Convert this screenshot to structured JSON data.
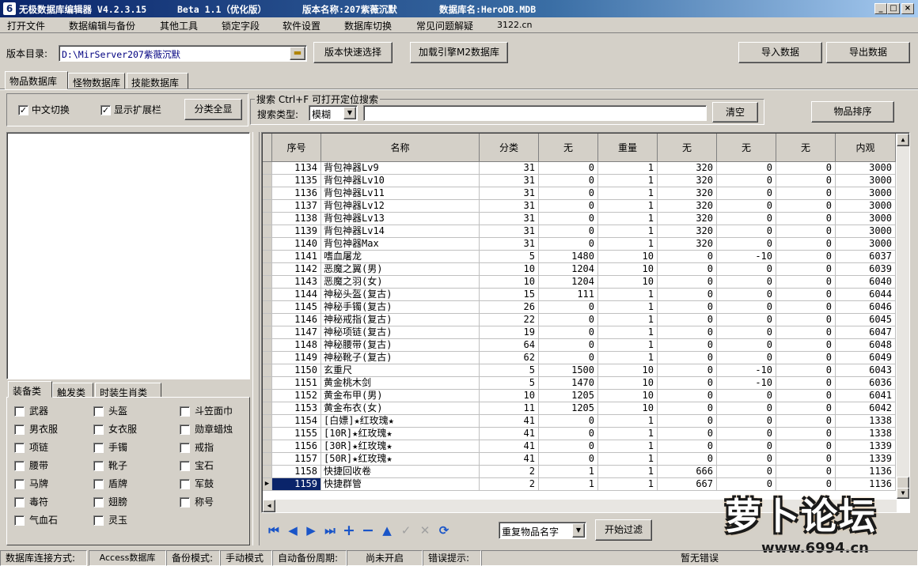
{
  "window": {
    "title_app": "无极数据库编辑器 V4.2.3.15",
    "title_beta": "Beta 1.1（优化版）",
    "title_version": "版本名称:207紫薇沉默",
    "title_db": "数据库名:HeroDB.MDB"
  },
  "menu": [
    "打开文件",
    "数据编辑与备份",
    "其他工具",
    "锁定字段",
    "软件设置",
    "数据库切换",
    "常见问题解疑",
    "3122.cn"
  ],
  "toolbar": {
    "dir_label": "版本目录:",
    "dir_value": "D:\\MirServer207紫薇沉默",
    "quick_select": "版本快速选择",
    "load_engine": "加载引擎M2数据库",
    "import": "导入数据",
    "export": "导出数据"
  },
  "tabs": [
    "物品数据库",
    "怪物数据库",
    "技能数据库"
  ],
  "options": {
    "chinese_switch": "中文切换",
    "show_ext": "显示扩展栏",
    "show_all": "分类全显",
    "search_group": "搜索  Ctrl+F 可打开定位搜索",
    "search_type_label": "搜索类型:",
    "search_type_value": "模糊",
    "clear": "清空",
    "sort": "物品排序"
  },
  "category_tabs": [
    "装备类",
    "触发类",
    "时装生肖类"
  ],
  "categories": [
    "武器",
    "头盔",
    "斗笠面巾",
    "男衣服",
    "女衣服",
    "勋章蜡烛",
    "项链",
    "手镯",
    "戒指",
    "腰带",
    "靴子",
    "宝石",
    "马牌",
    "盾牌",
    "军鼓",
    "毒符",
    "翅膀",
    "称号",
    "气血石",
    "灵玉"
  ],
  "columns": [
    "序号",
    "名称",
    "分类",
    "无",
    "重量",
    "无",
    "无",
    "无",
    "内观"
  ],
  "rows": [
    [
      "1134",
      "背包神器Lv9",
      "31",
      "0",
      "1",
      "320",
      "0",
      "0",
      "3000"
    ],
    [
      "1135",
      "背包神器Lv10",
      "31",
      "0",
      "1",
      "320",
      "0",
      "0",
      "3000"
    ],
    [
      "1136",
      "背包神器Lv11",
      "31",
      "0",
      "1",
      "320",
      "0",
      "0",
      "3000"
    ],
    [
      "1137",
      "背包神器Lv12",
      "31",
      "0",
      "1",
      "320",
      "0",
      "0",
      "3000"
    ],
    [
      "1138",
      "背包神器Lv13",
      "31",
      "0",
      "1",
      "320",
      "0",
      "0",
      "3000"
    ],
    [
      "1139",
      "背包神器Lv14",
      "31",
      "0",
      "1",
      "320",
      "0",
      "0",
      "3000"
    ],
    [
      "1140",
      "背包神器Max",
      "31",
      "0",
      "1",
      "320",
      "0",
      "0",
      "3000"
    ],
    [
      "1141",
      "嗜血屠龙",
      "5",
      "1480",
      "10",
      "0",
      "-10",
      "0",
      "6037"
    ],
    [
      "1142",
      "恶魔之翼(男)",
      "10",
      "1204",
      "10",
      "0",
      "0",
      "0",
      "6039"
    ],
    [
      "1143",
      "恶魔之羽(女)",
      "10",
      "1204",
      "10",
      "0",
      "0",
      "0",
      "6040"
    ],
    [
      "1144",
      "神秘头盔(复古)",
      "15",
      "111",
      "1",
      "0",
      "0",
      "0",
      "6044"
    ],
    [
      "1145",
      "神秘手镯(复古)",
      "26",
      "0",
      "1",
      "0",
      "0",
      "0",
      "6046"
    ],
    [
      "1146",
      "神秘戒指(复古)",
      "22",
      "0",
      "1",
      "0",
      "0",
      "0",
      "6045"
    ],
    [
      "1147",
      "神秘项链(复古)",
      "19",
      "0",
      "1",
      "0",
      "0",
      "0",
      "6047"
    ],
    [
      "1148",
      "神秘腰带(复古)",
      "64",
      "0",
      "1",
      "0",
      "0",
      "0",
      "6048"
    ],
    [
      "1149",
      "神秘靴子(复古)",
      "62",
      "0",
      "1",
      "0",
      "0",
      "0",
      "6049"
    ],
    [
      "1150",
      "玄重尺",
      "5",
      "1500",
      "10",
      "0",
      "-10",
      "0",
      "6043"
    ],
    [
      "1151",
      "黄金桃木剑",
      "5",
      "1470",
      "10",
      "0",
      "-10",
      "0",
      "6036"
    ],
    [
      "1152",
      "黄金布甲(男)",
      "10",
      "1205",
      "10",
      "0",
      "0",
      "0",
      "6041"
    ],
    [
      "1153",
      "黄金布衣(女)",
      "11",
      "1205",
      "10",
      "0",
      "0",
      "0",
      "6042"
    ],
    [
      "1154",
      "[白嫖]★红玫瑰★",
      "41",
      "0",
      "1",
      "0",
      "0",
      "0",
      "1338"
    ],
    [
      "1155",
      "[10R]★红玫瑰★",
      "41",
      "0",
      "1",
      "0",
      "0",
      "0",
      "1338"
    ],
    [
      "1156",
      "[30R]★红玫瑰★",
      "41",
      "0",
      "1",
      "0",
      "0",
      "0",
      "1339"
    ],
    [
      "1157",
      "[50R]★红玫瑰★",
      "41",
      "0",
      "1",
      "0",
      "0",
      "0",
      "1339"
    ],
    [
      "1158",
      "快捷回收卷",
      "2",
      "1",
      "1",
      "666",
      "0",
      "0",
      "1136"
    ],
    [
      "1159",
      "快捷群管",
      "2",
      "1",
      "1",
      "667",
      "0",
      "0",
      "1136"
    ]
  ],
  "filter": {
    "value": "重复物品名字",
    "start": "开始过滤"
  },
  "status": {
    "conn_label": "数据库连接方式:",
    "conn_value": "Access数据库",
    "backup_label": "备份模式:",
    "backup_value": "手动模式",
    "auto_label": "自动备份周期:",
    "auto_value": "尚未开启",
    "err_label": "错误提示:",
    "err_value": "暂无错误"
  },
  "watermark": {
    "text": "萝卜论坛",
    "url": "www.6994.cn"
  }
}
